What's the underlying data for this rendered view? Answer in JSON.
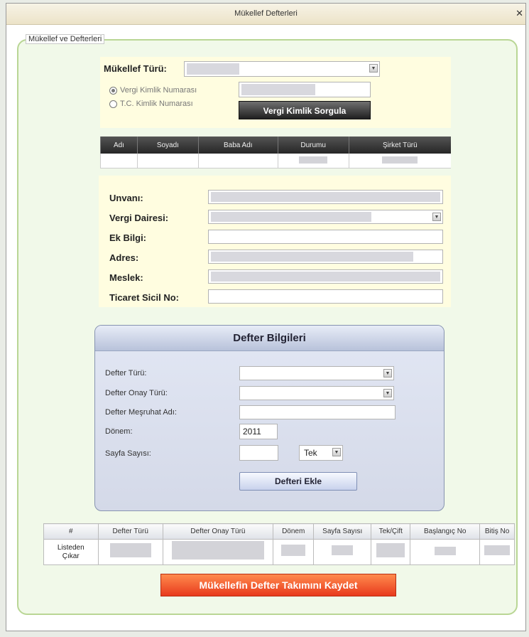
{
  "window": {
    "title": "Mükellef Defterleri"
  },
  "fieldset": {
    "legend": "Mükellef ve Defterleri"
  },
  "mukellef": {
    "type_label": "Mükellef Türü:",
    "radio_vkn": "Vergi Kimlik Numarası",
    "radio_tc": "T.C. Kimlik Numarası",
    "query_button": "Vergi Kimlik Sorgula"
  },
  "result_table": {
    "headers": [
      "Adı",
      "Soyadı",
      "Baba Adı",
      "Durumu",
      "Şirket Türü"
    ]
  },
  "details": {
    "unvan": "Unvanı:",
    "vergi_dairesi": "Vergi Dairesi:",
    "ek_bilgi": "Ek Bilgi:",
    "adres": "Adres:",
    "meslek": "Meslek:",
    "ticaret_sicil": "Ticaret Sicil No:"
  },
  "defter": {
    "title": "Defter Bilgileri",
    "turu": "Defter Türü:",
    "onay_turu": "Defter Onay Türü:",
    "mesruhat": "Defter Meşruhat Adı:",
    "donem": "Dönem:",
    "donem_value": "2011",
    "sayfa": "Sayfa Sayısı:",
    "tek_value": "Tek",
    "add_button": "Defteri Ekle"
  },
  "list_table": {
    "headers": [
      "#",
      "Defter Türü",
      "Defter Onay Türü",
      "Dönem",
      "Sayfa Sayısı",
      "Tek/Çift",
      "Başlangıç No",
      "Bitiş No"
    ],
    "row_action_line1": "Listeden",
    "row_action_line2": "Çıkar"
  },
  "save_button": "Mükellefin Defter Takımını Kaydet"
}
